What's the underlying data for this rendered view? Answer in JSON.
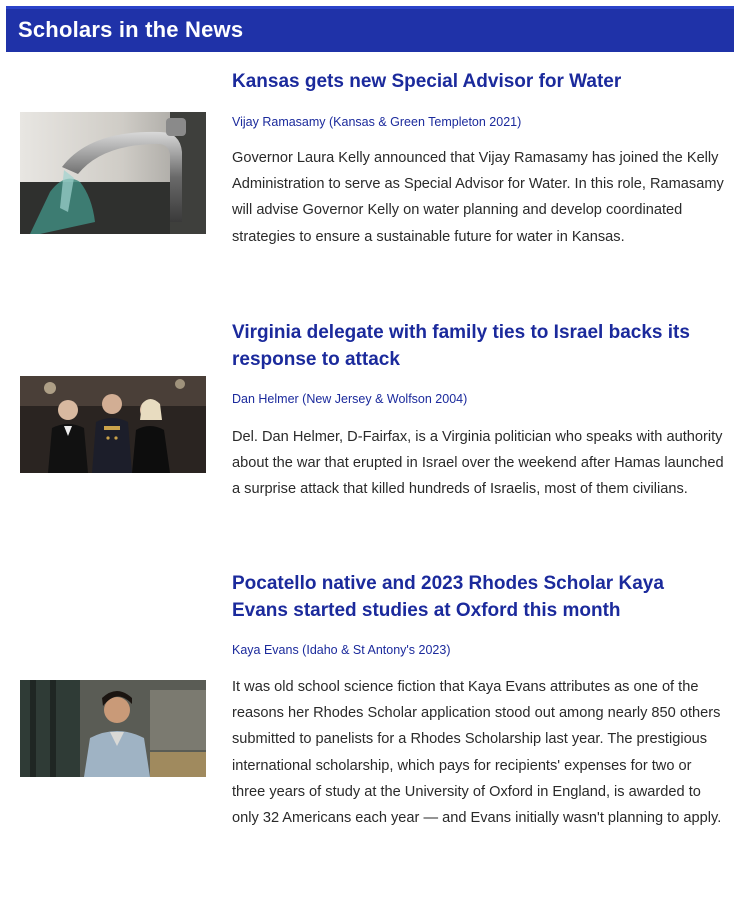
{
  "header": {
    "title": "Scholars in the News"
  },
  "articles": [
    {
      "title": "Kansas gets new Special Advisor for Water",
      "byline": "Vijay Ramasamy (Kansas & Green Templeton 2021)",
      "body": "Governor Laura Kelly announced that Vijay Ramasamy has joined the Kelly Administration to serve as Special Advisor for Water. In this role, Ramasamy will advise Governor Kelly on water planning and develop coordinated strategies to ensure a sustainable future for water in Kansas.",
      "image": "water-faucet-photo"
    },
    {
      "title": "Virginia delegate with family ties to Israel backs its response to attack",
      "byline": "Dan Helmer (New Jersey & Wolfson 2004)",
      "body": "Del. Dan Helmer, D-Fairfax, is a Virginia politician who speaks with authority about the war that erupted in Israel over the weekend after Hamas launched a surprise attack that killed hundreds of Israelis, most of them civilians.",
      "image": "formal-group-photo"
    },
    {
      "title": "Pocatello native and 2023 Rhodes Scholar Kaya Evans started studies at Oxford this month",
      "byline": "Kaya Evans (Idaho & St Antony's 2023)",
      "body": "It was old school science fiction that Kaya Evans attributes as one of the reasons her Rhodes Scholar application stood out among nearly 850 others submitted to panelists for a Rhodes Scholarship last year. The prestigious international scholarship, which pays for recipients' expenses for two or three years of study at the University of Oxford in England, is awarded to only 32 Americans each year — and Evans initially wasn't planning to apply.",
      "image": "student-portrait-photo"
    }
  ]
}
